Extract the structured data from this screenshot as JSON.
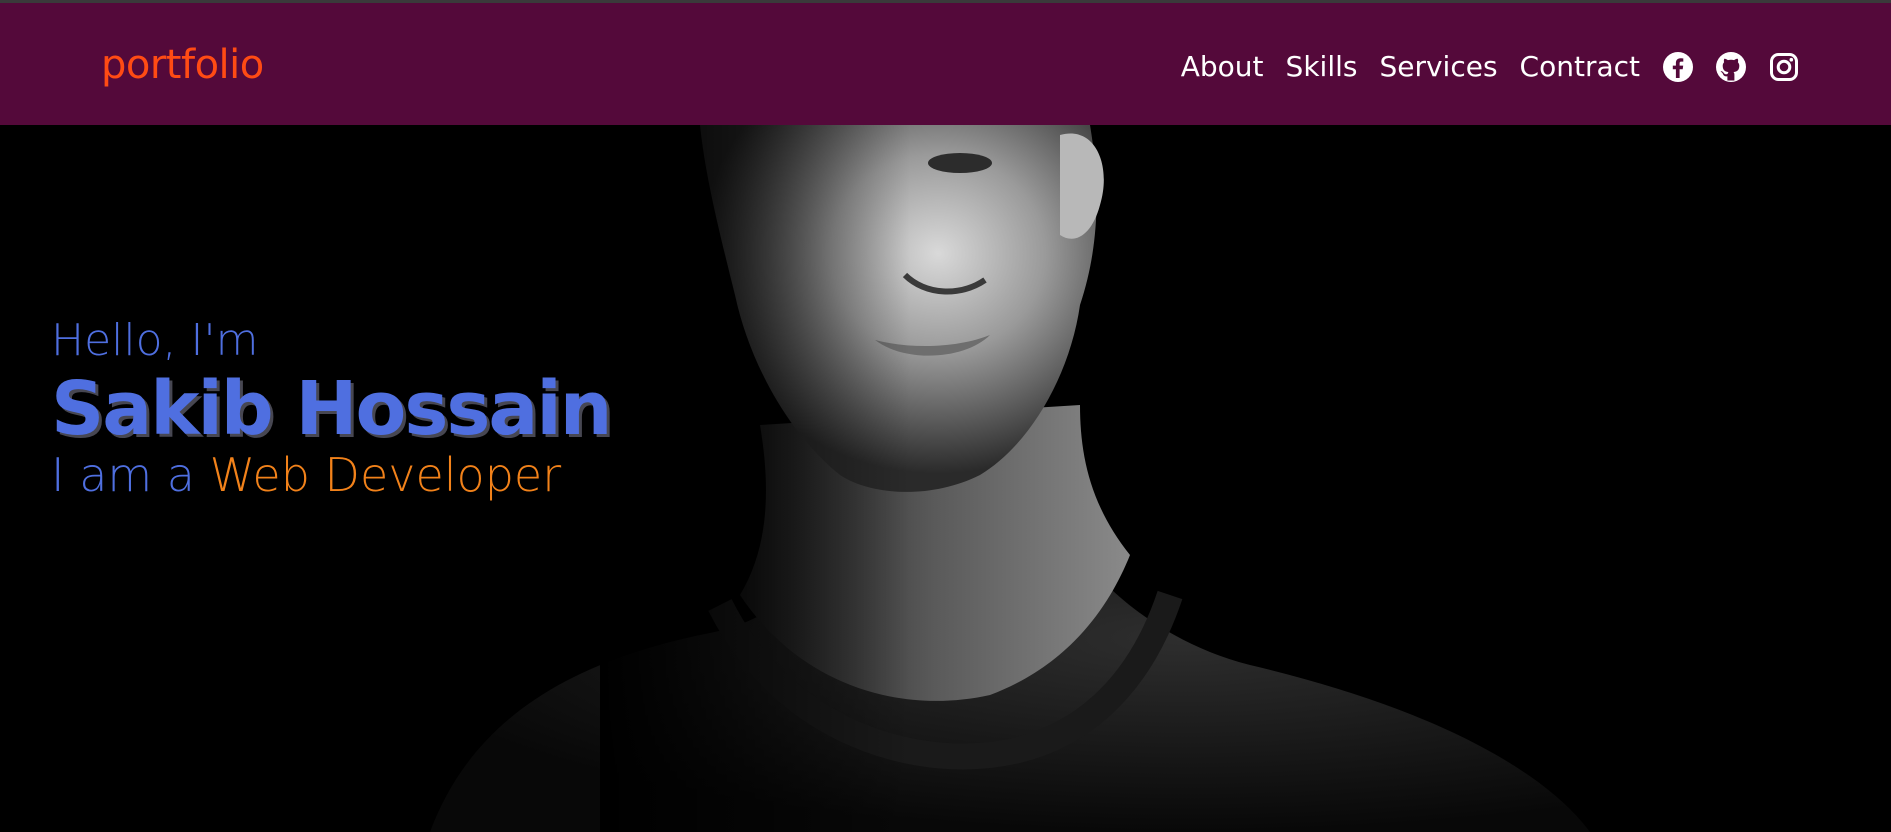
{
  "colors": {
    "navbar_bg": "#54093a",
    "brand": "#ff4b14",
    "nav_text": "#ffffff",
    "hero_blue": "#4f6fe0",
    "hero_orange": "#f2821a"
  },
  "header": {
    "brand": "portfolio",
    "nav": [
      {
        "label": "About"
      },
      {
        "label": "Skills"
      },
      {
        "label": "Services"
      },
      {
        "label": "Contract"
      }
    ],
    "social_icons": [
      "facebook-icon",
      "github-icon",
      "instagram-icon"
    ]
  },
  "hero": {
    "greeting": "Hello, I'm",
    "name": "Sakib Hossain",
    "role_prefix": "I am a ",
    "role_highlight": "Web Developer",
    "background_image": "portrait-photo"
  }
}
